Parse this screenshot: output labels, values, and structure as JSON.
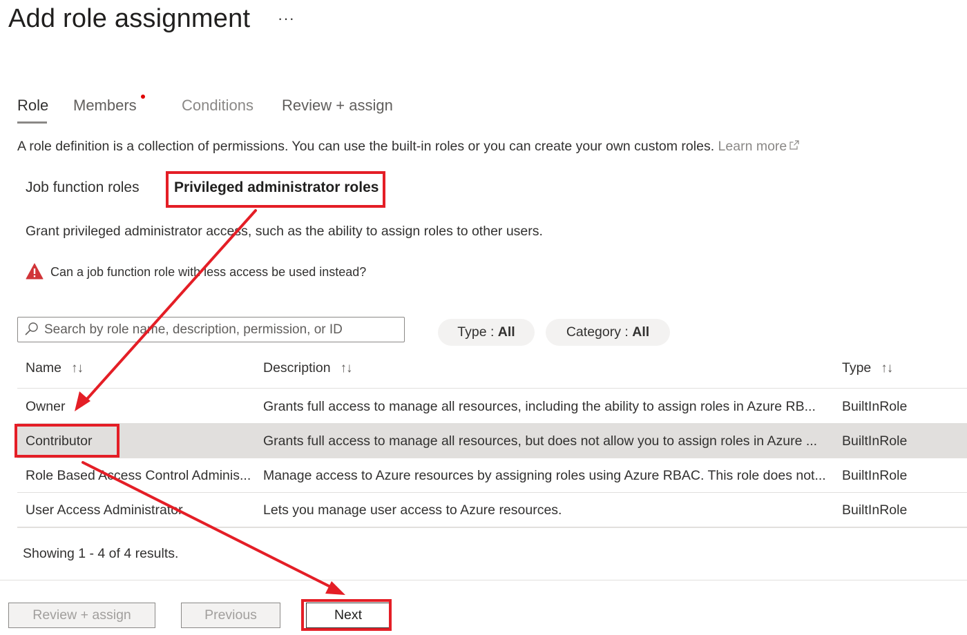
{
  "header": {
    "title": "Add role assignment",
    "more_label": "···"
  },
  "tabs": [
    {
      "label": "Role",
      "state": "active"
    },
    {
      "label": "Members",
      "state": "required"
    },
    {
      "label": "Conditions",
      "state": "disabled"
    },
    {
      "label": "Review + assign",
      "state": "enabled"
    }
  ],
  "intro": {
    "text": "A role definition is a collection of permissions. You can use the built-in roles or you can create your own custom roles.",
    "learn_more": "Learn more"
  },
  "role_pivots": {
    "items": [
      "Job function roles",
      "Privileged administrator roles"
    ],
    "selected": "Privileged administrator roles"
  },
  "privileged": {
    "description": "Grant privileged administrator access, such as the ability to assign roles to other users.",
    "warning": "Can a job function role with less access be used instead?"
  },
  "search": {
    "placeholder": "Search by role name, description, permission, or ID",
    "value": ""
  },
  "filters": [
    {
      "label": "Type : ",
      "value": "All"
    },
    {
      "label": "Category : ",
      "value": "All"
    }
  ],
  "table": {
    "columns": [
      "Name",
      "Description",
      "Type"
    ],
    "sort_icon": "↑↓",
    "rows": [
      {
        "name": "Owner",
        "description": "Grants full access to manage all resources, including the ability to assign roles in Azure RB...",
        "type": "BuiltInRole",
        "selected": false
      },
      {
        "name": "Contributor",
        "description": "Grants full access to manage all resources, but does not allow you to assign roles in Azure ...",
        "type": "BuiltInRole",
        "selected": true
      },
      {
        "name": "Role Based Access Control Adminis...",
        "description": "Manage access to Azure resources by assigning roles using Azure RBAC. This role does not...",
        "type": "BuiltInRole",
        "selected": false
      },
      {
        "name": "User Access Administrator",
        "description": "Lets you manage user access to Azure resources.",
        "type": "BuiltInRole",
        "selected": false
      }
    ]
  },
  "results_text": "Showing 1 - 4 of 4 results.",
  "footer": {
    "review_assign": "Review + assign",
    "previous": "Previous",
    "next": "Next"
  },
  "icons": {
    "more": "more-icon",
    "external_link": "external-link-icon",
    "warning": "warning-icon",
    "search": "search-icon",
    "sort": "sort-icon"
  },
  "colors": {
    "annotation_red": "#e41e26",
    "warning_red": "#d13438",
    "required_dot": "#e00000",
    "selected_row": "#e1dfdd",
    "pill_bg": "#f3f2f1"
  }
}
